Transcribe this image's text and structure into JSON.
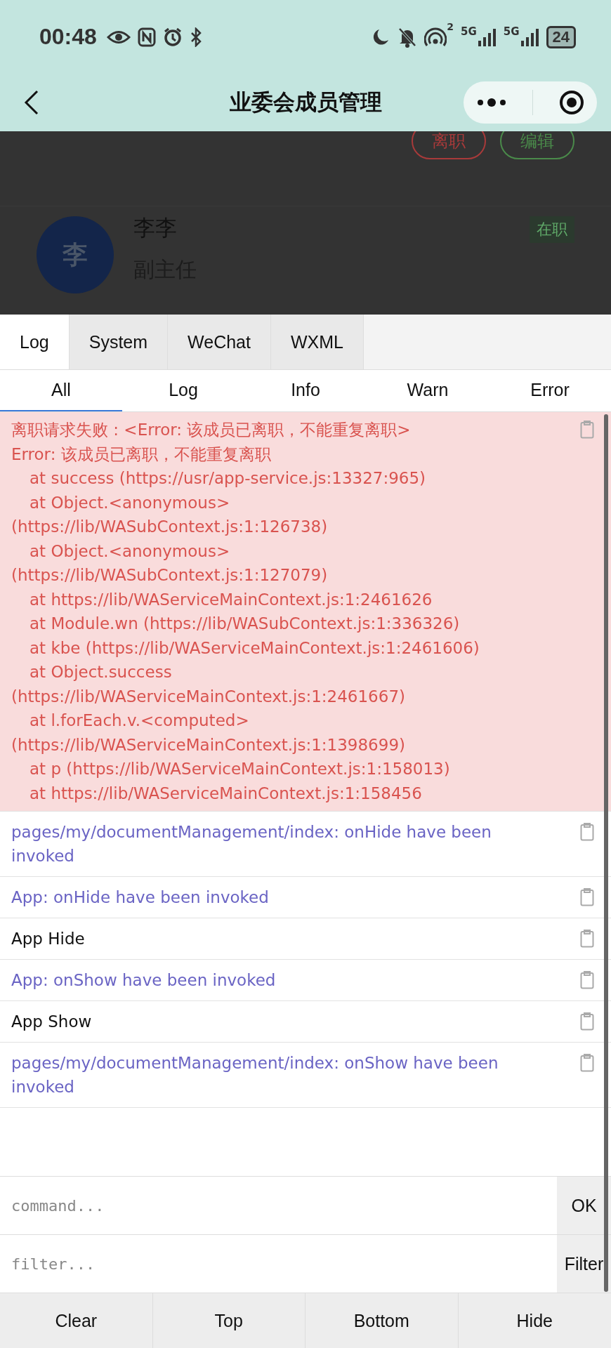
{
  "status_bar": {
    "time": "00:48",
    "hotspot_badge": "2",
    "sim_1": "5G",
    "sim_2": "5G",
    "battery": "24"
  },
  "nav": {
    "title": "业委会成员管理"
  },
  "page": {
    "actions": [
      {
        "label": "离职",
        "kind": "danger"
      },
      {
        "label": "编辑",
        "kind": "primary"
      }
    ],
    "member": {
      "avatar": "李",
      "name": "李李",
      "role": "副主任",
      "status": "在职"
    }
  },
  "console": {
    "tabs": [
      {
        "label": "Log",
        "selected": true
      },
      {
        "label": "System",
        "selected": false
      },
      {
        "label": "WeChat",
        "selected": false
      },
      {
        "label": "WXML",
        "selected": false
      }
    ],
    "filters": [
      {
        "label": "All",
        "selected": true
      },
      {
        "label": "Log",
        "selected": false
      },
      {
        "label": "Info",
        "selected": false
      },
      {
        "label": "Warn",
        "selected": false
      },
      {
        "label": "Error",
        "selected": false
      }
    ],
    "entries": [
      {
        "kind": "error",
        "lines": [
          {
            "text": "离职请求失败 : <Error: 该成员已离职，不能重复离职>",
            "indent": false
          },
          {
            "text": "Error: 该成员已离职，不能重复离职",
            "indent": false
          },
          {
            "text": "at success (https://usr/app-service.js:13327:965)",
            "indent": true
          },
          {
            "text": "at Object.<anonymous>",
            "indent": true
          },
          {
            "text": "(https://lib/WASubContext.js:1:126738)",
            "indent": false
          },
          {
            "text": "at Object.<anonymous>",
            "indent": true
          },
          {
            "text": "(https://lib/WASubContext.js:1:127079)",
            "indent": false
          },
          {
            "text": "at https://lib/WAServiceMainContext.js:1:2461626",
            "indent": true
          },
          {
            "text": "at Module.wn (https://lib/WASubContext.js:1:336326)",
            "indent": true
          },
          {
            "text": "at kbe (https://lib/WAServiceMainContext.js:1:2461606)",
            "indent": true
          },
          {
            "text": "at Object.success",
            "indent": true
          },
          {
            "text": "(https://lib/WAServiceMainContext.js:1:2461667)",
            "indent": false
          },
          {
            "text": "at l.forEach.v.<computed>",
            "indent": true
          },
          {
            "text": "(https://lib/WAServiceMainContext.js:1:1398699)",
            "indent": false
          },
          {
            "text": "at p (https://lib/WAServiceMainContext.js:1:158013)",
            "indent": true
          },
          {
            "text": "at https://lib/WAServiceMainContext.js:1:158456",
            "indent": true
          }
        ]
      },
      {
        "kind": "info",
        "text": "pages/my/documentManagement/index: onHide have been invoked"
      },
      {
        "kind": "info",
        "text": "App: onHide have been invoked"
      },
      {
        "kind": "log",
        "text": "App Hide"
      },
      {
        "kind": "info",
        "text": "App: onShow have been invoked"
      },
      {
        "kind": "log",
        "text": "App Show"
      },
      {
        "kind": "info",
        "text": "pages/my/documentManagement/index: onShow have been invoked"
      }
    ],
    "command": {
      "placeholder": "command..."
    },
    "ok_button": "OK",
    "filter": {
      "placeholder": "filter..."
    },
    "filter_button": "Filter",
    "toolbar": [
      "Clear",
      "Top",
      "Bottom",
      "Hide"
    ]
  }
}
